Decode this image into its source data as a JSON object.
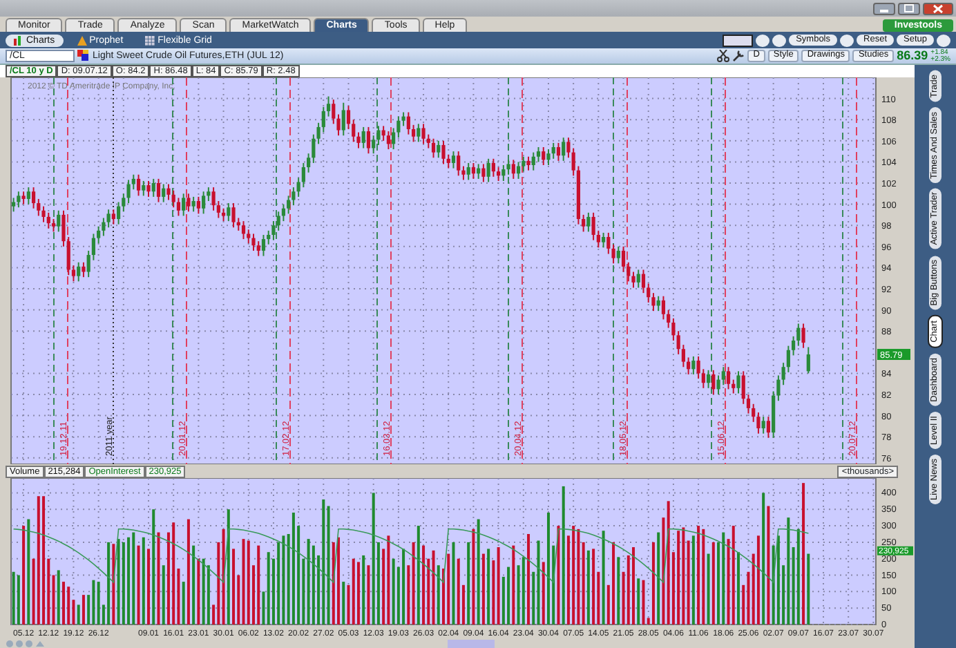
{
  "tabs": [
    {
      "label": "Monitor",
      "selected": false
    },
    {
      "label": "Trade",
      "selected": false
    },
    {
      "label": "Analyze",
      "selected": false
    },
    {
      "label": "Scan",
      "selected": false
    },
    {
      "label": "MarketWatch",
      "selected": false
    },
    {
      "label": "Charts",
      "selected": true
    },
    {
      "label": "Tools",
      "selected": false
    },
    {
      "label": "Help",
      "selected": false
    }
  ],
  "brand_button": "Investools",
  "subtabs": [
    {
      "label": "Charts",
      "selected": true
    },
    {
      "label": "Prophet",
      "selected": false
    },
    {
      "label": "Flexible Grid",
      "selected": false
    }
  ],
  "toolbar_buttons": [
    "Symbols",
    "Reset",
    "Setup"
  ],
  "symbol_bar": {
    "symbol": "/CL",
    "description": "Light Sweet Crude Oil Futures,ETH (JUL 12)",
    "period_button": "D",
    "buttons": [
      "Style",
      "Drawings",
      "Studies"
    ],
    "last_price": "86.39",
    "change": "+1.84",
    "change_pct": "+2.3%"
  },
  "quote_info": [
    "/CL 10 y D",
    "D: 09.07.12",
    "O: 84.2",
    "H: 86.48",
    "L: 84",
    "C: 85.79",
    "R: 2.48"
  ],
  "price_chart": {
    "copyright": "2012 © TD Ameritrade IP Company, Inc.",
    "price_label": "85.79",
    "event_lines": [
      {
        "label": "19.12.11",
        "kind": "expiry"
      },
      {
        "label": "2011 year",
        "kind": "year"
      },
      {
        "label": "20.01.12",
        "kind": "expiry"
      },
      {
        "label": "17.02.12",
        "kind": "expiry"
      },
      {
        "label": "16.03.12",
        "kind": "expiry"
      },
      {
        "label": "20.04.12",
        "kind": "expiry"
      },
      {
        "label": "18.05.12",
        "kind": "expiry"
      },
      {
        "label": "15.06.12",
        "kind": "expiry"
      },
      {
        "label": "20.07.12",
        "kind": "expiry"
      }
    ],
    "chart_data": {
      "type": "candlestick",
      "grid": true,
      "ylim": [
        75.4,
        112
      ],
      "yticks": [
        110,
        108,
        106,
        104,
        102,
        100,
        98,
        96,
        94,
        92,
        90,
        88,
        84,
        82,
        80,
        78,
        76
      ],
      "categories": [
        null,
        null,
        null,
        null,
        null,
        null,
        null,
        null,
        null,
        null,
        null,
        null,
        null,
        null,
        null,
        null,
        null,
        null,
        null,
        null,
        null,
        null,
        null,
        null,
        null,
        null,
        null,
        null,
        null,
        null,
        null,
        null,
        null,
        null,
        null,
        null,
        null,
        null,
        null,
        null,
        null,
        null,
        null,
        null,
        null,
        null,
        null,
        null,
        null,
        null,
        null,
        null,
        null,
        null,
        null,
        null,
        null,
        null,
        null,
        null,
        null,
        null,
        null,
        null,
        null,
        null,
        null,
        null,
        null,
        null,
        null,
        null,
        null,
        null,
        null,
        null,
        null,
        null,
        null,
        null,
        null,
        null,
        null,
        null,
        null,
        null,
        null,
        null,
        null,
        null,
        null,
        null,
        null,
        null,
        null,
        null,
        null,
        null,
        null,
        null,
        null,
        null,
        null,
        null,
        null,
        null,
        null,
        null,
        null,
        null,
        null,
        null,
        null,
        null,
        null,
        null,
        null,
        null,
        null,
        null,
        null,
        null,
        null,
        null,
        null,
        null,
        null,
        null,
        null,
        null,
        null,
        null,
        null,
        null,
        null,
        null,
        null,
        null,
        null,
        null,
        null,
        null,
        null,
        null,
        null,
        null,
        null,
        null,
        null,
        null,
        null,
        null,
        null,
        null,
        null,
        null,
        null,
        null,
        null,
        null,
        null,
        null,
        null,
        null,
        null,
        null,
        null,
        null,
        null,
        null,
        null,
        null,
        null
      ],
      "ohlc": [
        [
          99.8,
          100.6,
          99.3,
          100.2
        ],
        [
          100.2,
          101.2,
          99.7,
          100.8
        ],
        [
          100.8,
          101.2,
          100.0,
          100.5
        ],
        [
          100.5,
          101.6,
          100.0,
          101.2
        ],
        [
          101.2,
          101.6,
          99.6,
          100.1
        ],
        [
          100.1,
          100.5,
          98.9,
          99.4
        ],
        [
          99.4,
          99.8,
          98.3,
          98.8
        ],
        [
          98.8,
          99.2,
          97.7,
          98.2
        ],
        [
          98.2,
          98.6,
          97.4,
          97.9
        ],
        [
          97.9,
          99.4,
          97.4,
          99.0
        ],
        [
          99.0,
          99.4,
          96.0,
          96.5
        ],
        [
          96.5,
          96.9,
          93.3,
          93.8
        ],
        [
          93.8,
          94.2,
          92.7,
          93.2
        ],
        [
          93.2,
          94.5,
          92.7,
          94.1
        ],
        [
          94.1,
          94.5,
          93.1,
          93.6
        ],
        [
          93.6,
          95.6,
          93.1,
          95.2
        ],
        [
          95.2,
          97.2,
          94.7,
          96.8
        ],
        [
          96.8,
          97.9,
          96.3,
          97.5
        ],
        [
          97.5,
          98.7,
          97.0,
          98.3
        ],
        [
          98.3,
          99.5,
          97.8,
          99.1
        ],
        [
          99.1,
          99.5,
          98.1,
          98.6
        ],
        [
          98.6,
          100.2,
          98.1,
          99.8
        ],
        [
          99.8,
          101.0,
          99.3,
          100.6
        ],
        [
          100.6,
          102.3,
          100.1,
          101.9
        ],
        [
          101.9,
          102.8,
          101.4,
          102.4
        ],
        [
          102.4,
          102.8,
          100.8,
          101.3
        ],
        [
          101.3,
          102.2,
          100.8,
          101.8
        ],
        [
          101.8,
          102.2,
          100.7,
          101.2
        ],
        [
          101.2,
          102.4,
          100.7,
          102.0
        ],
        [
          102.0,
          102.4,
          100.2,
          100.7
        ],
        [
          100.7,
          101.9,
          100.2,
          101.5
        ],
        [
          101.5,
          101.9,
          100.4,
          100.9
        ],
        [
          100.9,
          101.3,
          99.7,
          100.2
        ],
        [
          100.2,
          100.6,
          98.9,
          99.4
        ],
        [
          99.4,
          101.0,
          98.9,
          100.6
        ],
        [
          100.6,
          101.0,
          99.3,
          99.8
        ],
        [
          99.8,
          100.7,
          99.3,
          100.3
        ],
        [
          100.3,
          100.7,
          99.1,
          99.6
        ],
        [
          99.6,
          101.2,
          99.1,
          100.8
        ],
        [
          100.8,
          101.6,
          100.3,
          101.2
        ],
        [
          101.2,
          101.6,
          99.4,
          99.9
        ],
        [
          99.9,
          100.3,
          98.7,
          99.2
        ],
        [
          99.2,
          99.6,
          98.4,
          98.9
        ],
        [
          98.9,
          100.1,
          98.4,
          99.7
        ],
        [
          99.7,
          100.1,
          97.8,
          98.3
        ],
        [
          98.3,
          98.7,
          97.5,
          98.0
        ],
        [
          98.0,
          98.4,
          96.7,
          97.2
        ],
        [
          97.2,
          97.6,
          96.3,
          96.8
        ],
        [
          96.8,
          97.2,
          95.6,
          96.1
        ],
        [
          96.1,
          96.5,
          95.1,
          95.6
        ],
        [
          95.6,
          97.1,
          95.1,
          96.7
        ],
        [
          96.7,
          97.5,
          96.2,
          97.1
        ],
        [
          97.1,
          98.4,
          96.6,
          98.0
        ],
        [
          98.0,
          99.3,
          97.5,
          98.9
        ],
        [
          98.9,
          100.0,
          98.4,
          99.6
        ],
        [
          99.6,
          100.8,
          99.1,
          100.4
        ],
        [
          100.4,
          101.6,
          99.9,
          101.2
        ],
        [
          101.2,
          102.5,
          100.7,
          102.1
        ],
        [
          102.1,
          103.9,
          101.6,
          103.5
        ],
        [
          103.5,
          104.8,
          103.0,
          104.4
        ],
        [
          104.4,
          106.6,
          103.9,
          106.2
        ],
        [
          106.2,
          107.7,
          105.7,
          107.3
        ],
        [
          107.3,
          109.2,
          106.8,
          108.8
        ],
        [
          108.8,
          110.2,
          108.3,
          109.5
        ],
        [
          109.5,
          109.9,
          107.6,
          108.1
        ],
        [
          108.1,
          108.5,
          106.5,
          107.0
        ],
        [
          107.0,
          109.6,
          106.5,
          108.9
        ],
        [
          108.9,
          109.3,
          107.1,
          107.6
        ],
        [
          107.6,
          108.0,
          105.9,
          106.4
        ],
        [
          106.4,
          106.8,
          105.3,
          105.8
        ],
        [
          105.8,
          107.3,
          105.3,
          106.9
        ],
        [
          106.9,
          107.3,
          104.8,
          105.3
        ],
        [
          105.3,
          106.5,
          104.8,
          106.1
        ],
        [
          106.1,
          107.4,
          105.6,
          107.0
        ],
        [
          107.0,
          107.4,
          106.0,
          106.5
        ],
        [
          106.5,
          106.9,
          105.2,
          105.7
        ],
        [
          105.7,
          107.2,
          105.2,
          106.8
        ],
        [
          106.8,
          108.3,
          106.3,
          107.9
        ],
        [
          107.9,
          108.7,
          107.4,
          108.3
        ],
        [
          108.3,
          108.7,
          106.6,
          107.1
        ],
        [
          107.1,
          107.5,
          105.9,
          106.4
        ],
        [
          106.4,
          107.6,
          105.9,
          107.2
        ],
        [
          107.2,
          107.6,
          105.7,
          106.2
        ],
        [
          106.2,
          106.6,
          105.3,
          105.8
        ],
        [
          105.8,
          106.2,
          104.4,
          104.9
        ],
        [
          104.9,
          106.0,
          104.4,
          105.6
        ],
        [
          105.6,
          106.0,
          103.8,
          104.3
        ],
        [
          104.3,
          104.7,
          103.4,
          103.9
        ],
        [
          103.9,
          105.0,
          103.4,
          104.6
        ],
        [
          104.6,
          105.0,
          102.7,
          103.2
        ],
        [
          103.2,
          103.6,
          102.3,
          102.8
        ],
        [
          102.8,
          103.9,
          102.3,
          103.5
        ],
        [
          103.5,
          103.9,
          102.4,
          102.9
        ],
        [
          102.9,
          103.8,
          102.4,
          103.4
        ],
        [
          103.4,
          103.8,
          102.1,
          102.6
        ],
        [
          102.6,
          104.3,
          102.1,
          103.9
        ],
        [
          103.9,
          104.3,
          102.6,
          103.1
        ],
        [
          103.1,
          103.5,
          102.2,
          102.7
        ],
        [
          102.7,
          103.7,
          102.2,
          103.3
        ],
        [
          103.3,
          104.2,
          102.8,
          103.8
        ],
        [
          103.8,
          104.2,
          102.4,
          102.9
        ],
        [
          102.9,
          104.0,
          102.4,
          103.6
        ],
        [
          103.6,
          104.5,
          103.1,
          104.1
        ],
        [
          104.1,
          104.5,
          103.2,
          103.7
        ],
        [
          103.7,
          104.9,
          103.2,
          104.5
        ],
        [
          104.5,
          105.4,
          104.0,
          105.0
        ],
        [
          105.0,
          105.4,
          103.7,
          104.2
        ],
        [
          104.2,
          105.2,
          103.7,
          104.8
        ],
        [
          104.8,
          105.8,
          104.3,
          105.4
        ],
        [
          105.4,
          105.8,
          104.1,
          104.6
        ],
        [
          104.6,
          106.3,
          104.1,
          105.9
        ],
        [
          105.9,
          106.3,
          104.4,
          104.9
        ],
        [
          104.9,
          105.3,
          102.7,
          103.2
        ],
        [
          103.2,
          103.6,
          98.1,
          98.6
        ],
        [
          98.6,
          99.0,
          97.4,
          97.9
        ],
        [
          97.9,
          99.2,
          97.4,
          98.8
        ],
        [
          98.8,
          99.2,
          96.6,
          97.1
        ],
        [
          97.1,
          97.5,
          95.9,
          96.4
        ],
        [
          96.4,
          97.3,
          95.9,
          96.9
        ],
        [
          96.9,
          97.3,
          95.3,
          95.8
        ],
        [
          95.8,
          96.2,
          94.4,
          94.9
        ],
        [
          94.9,
          96.0,
          94.4,
          95.6
        ],
        [
          95.6,
          96.0,
          93.6,
          94.1
        ],
        [
          94.1,
          94.5,
          92.7,
          93.2
        ],
        [
          93.2,
          93.6,
          92.1,
          92.6
        ],
        [
          92.6,
          93.8,
          92.1,
          93.4
        ],
        [
          93.4,
          93.8,
          91.6,
          92.1
        ],
        [
          92.1,
          92.5,
          90.7,
          91.2
        ],
        [
          91.2,
          91.6,
          89.9,
          90.4
        ],
        [
          90.4,
          91.3,
          89.9,
          90.9
        ],
        [
          90.9,
          91.3,
          89.1,
          89.6
        ],
        [
          89.6,
          90.0,
          88.3,
          88.8
        ],
        [
          88.8,
          89.2,
          87.1,
          87.6
        ],
        [
          87.6,
          88.0,
          85.8,
          86.3
        ],
        [
          86.3,
          86.7,
          84.6,
          85.1
        ],
        [
          85.1,
          85.5,
          83.9,
          84.4
        ],
        [
          84.4,
          85.6,
          83.9,
          85.2
        ],
        [
          85.2,
          85.6,
          83.5,
          84.0
        ],
        [
          84.0,
          84.4,
          82.6,
          83.1
        ],
        [
          83.1,
          84.3,
          82.6,
          83.9
        ],
        [
          83.9,
          84.3,
          82.0,
          82.5
        ],
        [
          82.5,
          83.8,
          82.0,
          83.4
        ],
        [
          83.4,
          84.6,
          82.9,
          84.2
        ],
        [
          84.2,
          84.6,
          82.5,
          83.0
        ],
        [
          83.0,
          83.4,
          82.1,
          82.6
        ],
        [
          82.6,
          84.2,
          82.1,
          83.8
        ],
        [
          83.8,
          84.2,
          81.1,
          81.6
        ],
        [
          81.6,
          82.0,
          80.2,
          80.7
        ],
        [
          80.7,
          81.1,
          79.4,
          79.9
        ],
        [
          79.9,
          80.3,
          78.3,
          78.8
        ],
        [
          78.8,
          79.9,
          78.3,
          79.5
        ],
        [
          79.5,
          79.9,
          77.9,
          78.4
        ],
        [
          78.4,
          82.3,
          77.9,
          81.9
        ],
        [
          81.9,
          83.8,
          81.4,
          83.4
        ],
        [
          83.4,
          85.0,
          82.9,
          84.6
        ],
        [
          84.6,
          86.6,
          84.1,
          86.2
        ],
        [
          86.2,
          87.5,
          85.7,
          87.1
        ],
        [
          87.1,
          88.7,
          86.6,
          88.3
        ],
        [
          88.3,
          88.7,
          86.4,
          86.9
        ],
        [
          84.2,
          86.48,
          84.0,
          85.79
        ],
        null,
        null,
        null,
        null,
        null,
        null,
        null,
        null,
        null,
        null,
        null,
        null,
        null
      ]
    }
  },
  "volume_pane": {
    "fields": [
      {
        "label": "Volume",
        "value": "215,284"
      },
      {
        "label": "OpenInterest",
        "value": "230,925"
      }
    ],
    "units": "<thousands>",
    "oi_label": "230,925",
    "chart_data": {
      "type": "bar",
      "grid": true,
      "ylim": [
        0,
        445
      ],
      "yticks": [
        400,
        350,
        300,
        250,
        200,
        150,
        100,
        50,
        0
      ],
      "categories": [
        null,
        null,
        "05.12",
        null,
        null,
        null,
        null,
        "12.12",
        null,
        null,
        null,
        null,
        "19.12",
        null,
        null,
        null,
        null,
        "26.12",
        null,
        null,
        null,
        null,
        null,
        null,
        null,
        null,
        null,
        "09.01",
        null,
        null,
        null,
        null,
        "16.01",
        null,
        null,
        null,
        null,
        "23.01",
        null,
        null,
        null,
        null,
        "30.01",
        null,
        null,
        null,
        null,
        "06.02",
        null,
        null,
        null,
        null,
        "13.02",
        null,
        null,
        null,
        null,
        "20.02",
        null,
        null,
        null,
        null,
        "27.02",
        null,
        null,
        null,
        null,
        "05.03",
        null,
        null,
        null,
        null,
        "12.03",
        null,
        null,
        null,
        null,
        "19.03",
        null,
        null,
        null,
        null,
        "26.03",
        null,
        null,
        null,
        null,
        "02.04",
        null,
        null,
        null,
        null,
        "09.04",
        null,
        null,
        null,
        null,
        "16.04",
        null,
        null,
        null,
        null,
        "23.04",
        null,
        null,
        null,
        null,
        "30.04",
        null,
        null,
        null,
        null,
        "07.05",
        null,
        null,
        null,
        null,
        "14.05",
        null,
        null,
        null,
        null,
        "21.05",
        null,
        null,
        null,
        null,
        "28.05",
        null,
        null,
        null,
        null,
        "04.06",
        null,
        null,
        null,
        null,
        "11.06",
        null,
        null,
        null,
        null,
        "18.06",
        null,
        null,
        null,
        null,
        "25.06",
        null,
        null,
        null,
        null,
        "02.07",
        null,
        null,
        null,
        null,
        "09.07",
        null,
        null,
        null,
        null,
        "16.07",
        null,
        null,
        null,
        null,
        "23.07",
        null,
        null,
        null,
        null,
        "30.07"
      ],
      "series": [
        {
          "type": "bar",
          "colors": [
            "#1f8a2e",
            "#1f8a2e",
            "#c8102e",
            "#1f8a2e",
            "#c8102e",
            "#c8102e",
            "#c8102e",
            "#c8102e",
            "#c8102e",
            "#1f8a2e",
            "#c8102e",
            "#c8102e",
            "#c8102e",
            "#1f8a2e",
            "#c8102e",
            "#1f8a2e",
            "#1f8a2e",
            "#1f8a2e",
            "#1f8a2e",
            "#1f8a2e",
            "#c8102e",
            "#1f8a2e",
            "#1f8a2e",
            "#1f8a2e",
            "#1f8a2e",
            "#c8102e",
            "#1f8a2e",
            "#c8102e",
            "#1f8a2e",
            "#c8102e",
            "#1f8a2e",
            "#c8102e",
            "#c8102e",
            "#c8102e",
            "#1f8a2e",
            "#c8102e",
            "#1f8a2e",
            "#c8102e",
            "#1f8a2e",
            "#1f8a2e",
            "#c8102e",
            "#c8102e",
            "#c8102e",
            "#1f8a2e",
            "#c8102e",
            "#c8102e",
            "#c8102e",
            "#c8102e",
            "#c8102e",
            "#c8102e",
            "#1f8a2e",
            "#1f8a2e",
            "#1f8a2e",
            "#1f8a2e",
            "#1f8a2e",
            "#1f8a2e",
            "#1f8a2e",
            "#1f8a2e",
            "#1f8a2e",
            "#1f8a2e",
            "#1f8a2e",
            "#1f8a2e",
            "#1f8a2e",
            "#1f8a2e",
            "#c8102e",
            "#c8102e",
            "#1f8a2e",
            "#c8102e",
            "#c8102e",
            "#c8102e",
            "#1f8a2e",
            "#c8102e",
            "#1f8a2e",
            "#1f8a2e",
            "#c8102e",
            "#c8102e",
            "#1f8a2e",
            "#1f8a2e",
            "#1f8a2e",
            "#c8102e",
            "#c8102e",
            "#1f8a2e",
            "#c8102e",
            "#c8102e",
            "#c8102e",
            "#1f8a2e",
            "#c8102e",
            "#c8102e",
            "#1f8a2e",
            "#c8102e",
            "#c8102e",
            "#1f8a2e",
            "#c8102e",
            "#1f8a2e",
            "#c8102e",
            "#1f8a2e",
            "#c8102e",
            "#c8102e",
            "#1f8a2e",
            "#1f8a2e",
            "#c8102e",
            "#1f8a2e",
            "#1f8a2e",
            "#c8102e",
            "#1f8a2e",
            "#1f8a2e",
            "#c8102e",
            "#1f8a2e",
            "#1f8a2e",
            "#c8102e",
            "#1f8a2e",
            "#c8102e",
            "#c8102e",
            "#c8102e",
            "#c8102e",
            "#1f8a2e",
            "#c8102e",
            "#c8102e",
            "#1f8a2e",
            "#c8102e",
            "#c8102e",
            "#1f8a2e",
            "#c8102e",
            "#c8102e",
            "#c8102e",
            "#1f8a2e",
            "#c8102e",
            "#c8102e",
            "#c8102e",
            "#1f8a2e",
            "#c8102e",
            "#c8102e",
            "#c8102e",
            "#c8102e",
            "#c8102e",
            "#c8102e",
            "#1f8a2e",
            "#c8102e",
            "#c8102e",
            "#1f8a2e",
            "#c8102e",
            "#1f8a2e",
            "#1f8a2e",
            "#c8102e",
            "#c8102e",
            "#1f8a2e",
            "#c8102e",
            "#c8102e",
            "#c8102e",
            "#c8102e",
            "#1f8a2e",
            "#c8102e",
            "#1f8a2e",
            "#1f8a2e",
            "#1f8a2e",
            "#1f8a2e",
            "#1f8a2e",
            "#1f8a2e",
            "#c8102e",
            "#1f8a2e",
            null,
            null,
            null,
            null,
            null,
            null,
            null,
            null,
            null,
            null,
            null,
            null,
            null
          ],
          "values": [
            160,
            150,
            300,
            320,
            200,
            390,
            390,
            200,
            150,
            165,
            130,
            115,
            75,
            60,
            90,
            90,
            135,
            130,
            60,
            250,
            245,
            260,
            250,
            265,
            280,
            240,
            265,
            230,
            350,
            280,
            180,
            280,
            310,
            170,
            130,
            320,
            240,
            200,
            200,
            180,
            60,
            250,
            290,
            350,
            230,
            150,
            260,
            255,
            180,
            240,
            100,
            220,
            200,
            250,
            270,
            275,
            340,
            300,
            200,
            260,
            240,
            210,
            380,
            360,
            250,
            265,
            130,
            120,
            200,
            190,
            210,
            180,
            400,
            250,
            230,
            270,
            200,
            175,
            230,
            180,
            250,
            300,
            240,
            200,
            225,
            180,
            170,
            215,
            250,
            200,
            120,
            250,
            290,
            320,
            215,
            230,
            195,
            235,
            145,
            175,
            240,
            180,
            205,
            275,
            160,
            255,
            190,
            340,
            240,
            300,
            420,
            270,
            300,
            290,
            250,
            225,
            230,
            160,
            285,
            120,
            250,
            205,
            160,
            210,
            235,
            140,
            135,
            20,
            250,
            280,
            325,
            375,
            220,
            285,
            295,
            255,
            270,
            300,
            290,
            215,
            250,
            250,
            280,
            260,
            300,
            220,
            120,
            160,
            215,
            270,
            400,
            360,
            240,
            270,
            180,
            325,
            235,
            290,
            430,
            215,
            null,
            null,
            null,
            null,
            null,
            null,
            null,
            null,
            null,
            null,
            null,
            null,
            null
          ]
        },
        {
          "type": "line",
          "color": "#3a9a5a",
          "values": [
            290,
            289,
            287,
            284,
            281,
            277,
            272,
            266,
            260,
            253,
            245,
            237,
            228,
            218,
            207,
            196,
            184,
            171,
            157,
            143,
            128,
            290,
            290,
            289,
            287,
            284,
            281,
            277,
            272,
            266,
            260,
            253,
            245,
            237,
            228,
            218,
            207,
            196,
            184,
            171,
            157,
            143,
            128,
            290,
            290,
            289,
            287,
            284,
            281,
            277,
            272,
            266,
            260,
            253,
            245,
            237,
            228,
            218,
            207,
            196,
            184,
            171,
            157,
            143,
            128,
            290,
            290,
            289,
            287,
            284,
            281,
            277,
            272,
            266,
            260,
            253,
            245,
            237,
            228,
            218,
            207,
            196,
            184,
            171,
            157,
            143,
            128,
            290,
            290,
            289,
            287,
            284,
            281,
            277,
            272,
            266,
            260,
            253,
            245,
            237,
            228,
            218,
            207,
            196,
            184,
            171,
            157,
            143,
            128,
            290,
            290,
            289,
            287,
            284,
            281,
            277,
            272,
            266,
            260,
            253,
            245,
            237,
            228,
            218,
            207,
            196,
            184,
            171,
            157,
            143,
            128,
            290,
            290,
            289,
            287,
            284,
            281,
            277,
            272,
            266,
            260,
            253,
            245,
            237,
            228,
            218,
            207,
            196,
            184,
            171,
            157,
            143,
            128,
            290,
            290,
            289,
            287,
            284,
            281,
            277,
            null,
            null,
            null,
            null,
            null,
            null,
            null,
            null,
            null,
            null,
            null,
            null,
            null
          ]
        }
      ]
    }
  },
  "side_tabs": [
    {
      "label": "Trade",
      "selected": false
    },
    {
      "label": "Times And Sales",
      "selected": false
    },
    {
      "label": "Active Trader",
      "selected": false
    },
    {
      "label": "Big Buttons",
      "selected": false
    },
    {
      "label": "Chart",
      "selected": true
    },
    {
      "label": "Dashboard",
      "selected": false
    },
    {
      "label": "Level II",
      "selected": false
    },
    {
      "label": "Live News",
      "selected": false
    }
  ]
}
